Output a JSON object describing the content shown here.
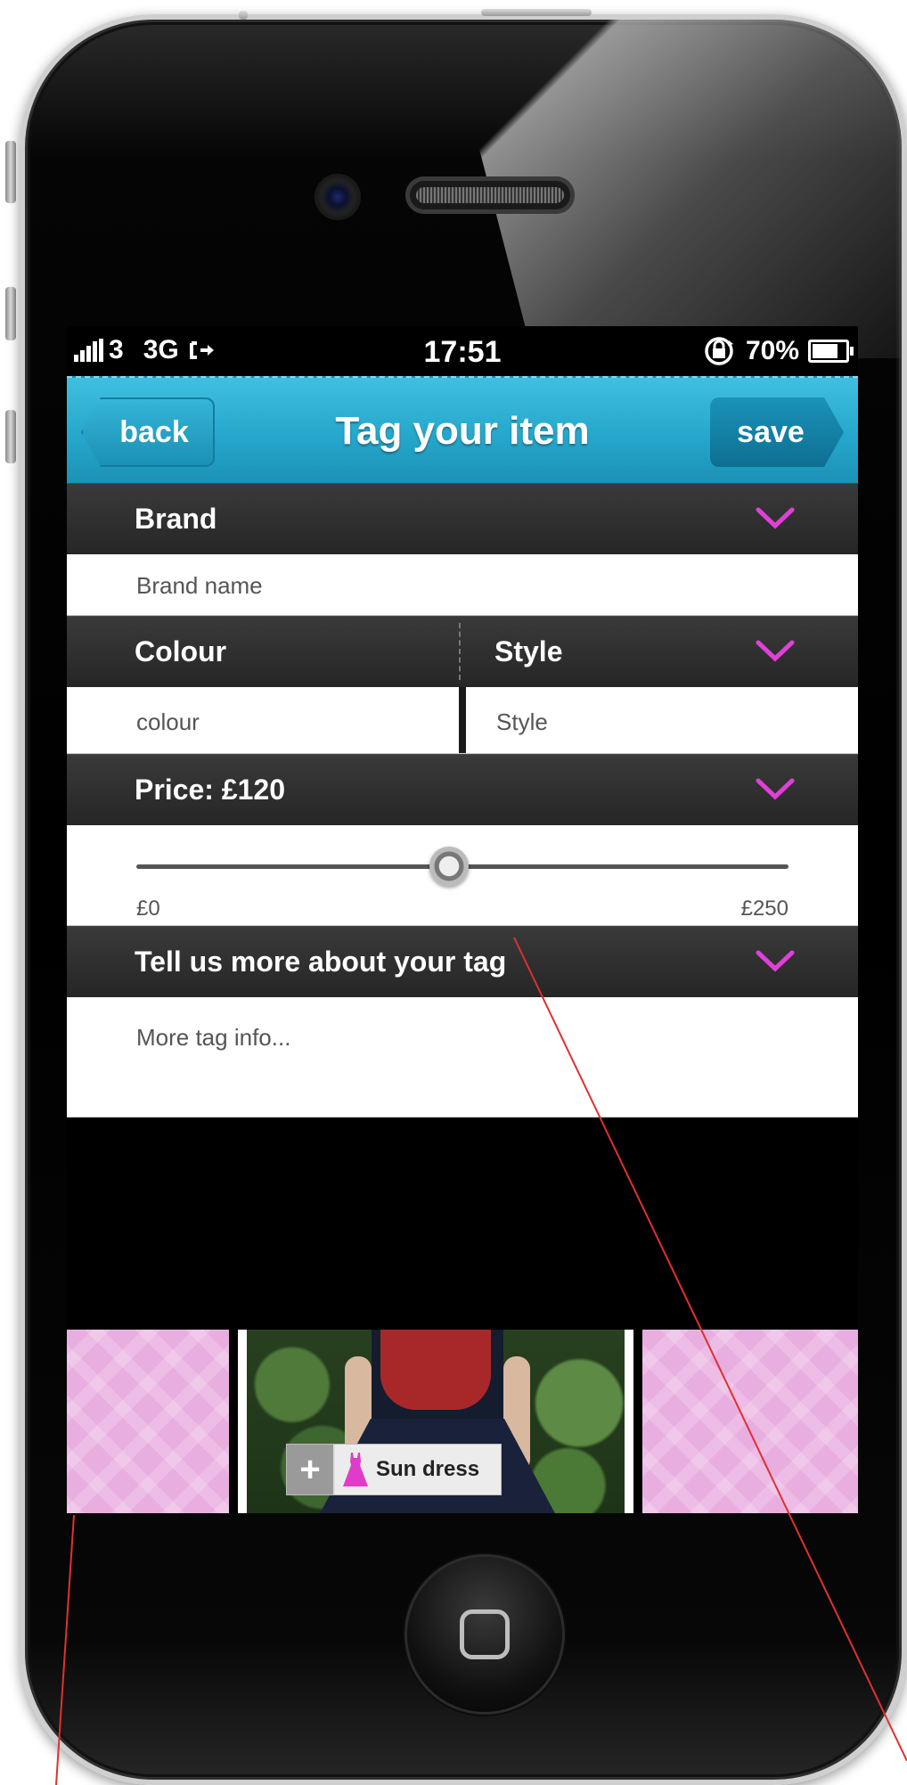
{
  "status_bar": {
    "carrier": "3",
    "network": "3G",
    "time": "17:51",
    "battery": "70%"
  },
  "nav": {
    "back_label": "back",
    "title": "Tag your item",
    "save_label": "save"
  },
  "form": {
    "brand": {
      "label": "Brand",
      "placeholder": "Brand name"
    },
    "colour": {
      "label": "Colour",
      "placeholder": "colour"
    },
    "style": {
      "label": "Style",
      "placeholder": "Style"
    },
    "price": {
      "label": "Price: £120",
      "min_label": "£0",
      "max_label": "£250",
      "value": 120,
      "min": 0,
      "max": 250
    },
    "more": {
      "label": "Tell us more about your tag",
      "placeholder": "More tag info..."
    }
  },
  "gallery": {
    "tag_label": "Sun dress"
  },
  "colors": {
    "accent": "#2aaad2",
    "chevron": "#e040d8",
    "header_bg": "#2e2e2e",
    "gallery_pink": "#e9aee0",
    "annotation_line": "#e03030"
  },
  "icons": [
    "signal-icon",
    "share-arrow-icon",
    "rotation-lock-icon",
    "battery-icon",
    "chevron-down-icon",
    "plus-icon",
    "dress-icon",
    "home-square-icon"
  ]
}
